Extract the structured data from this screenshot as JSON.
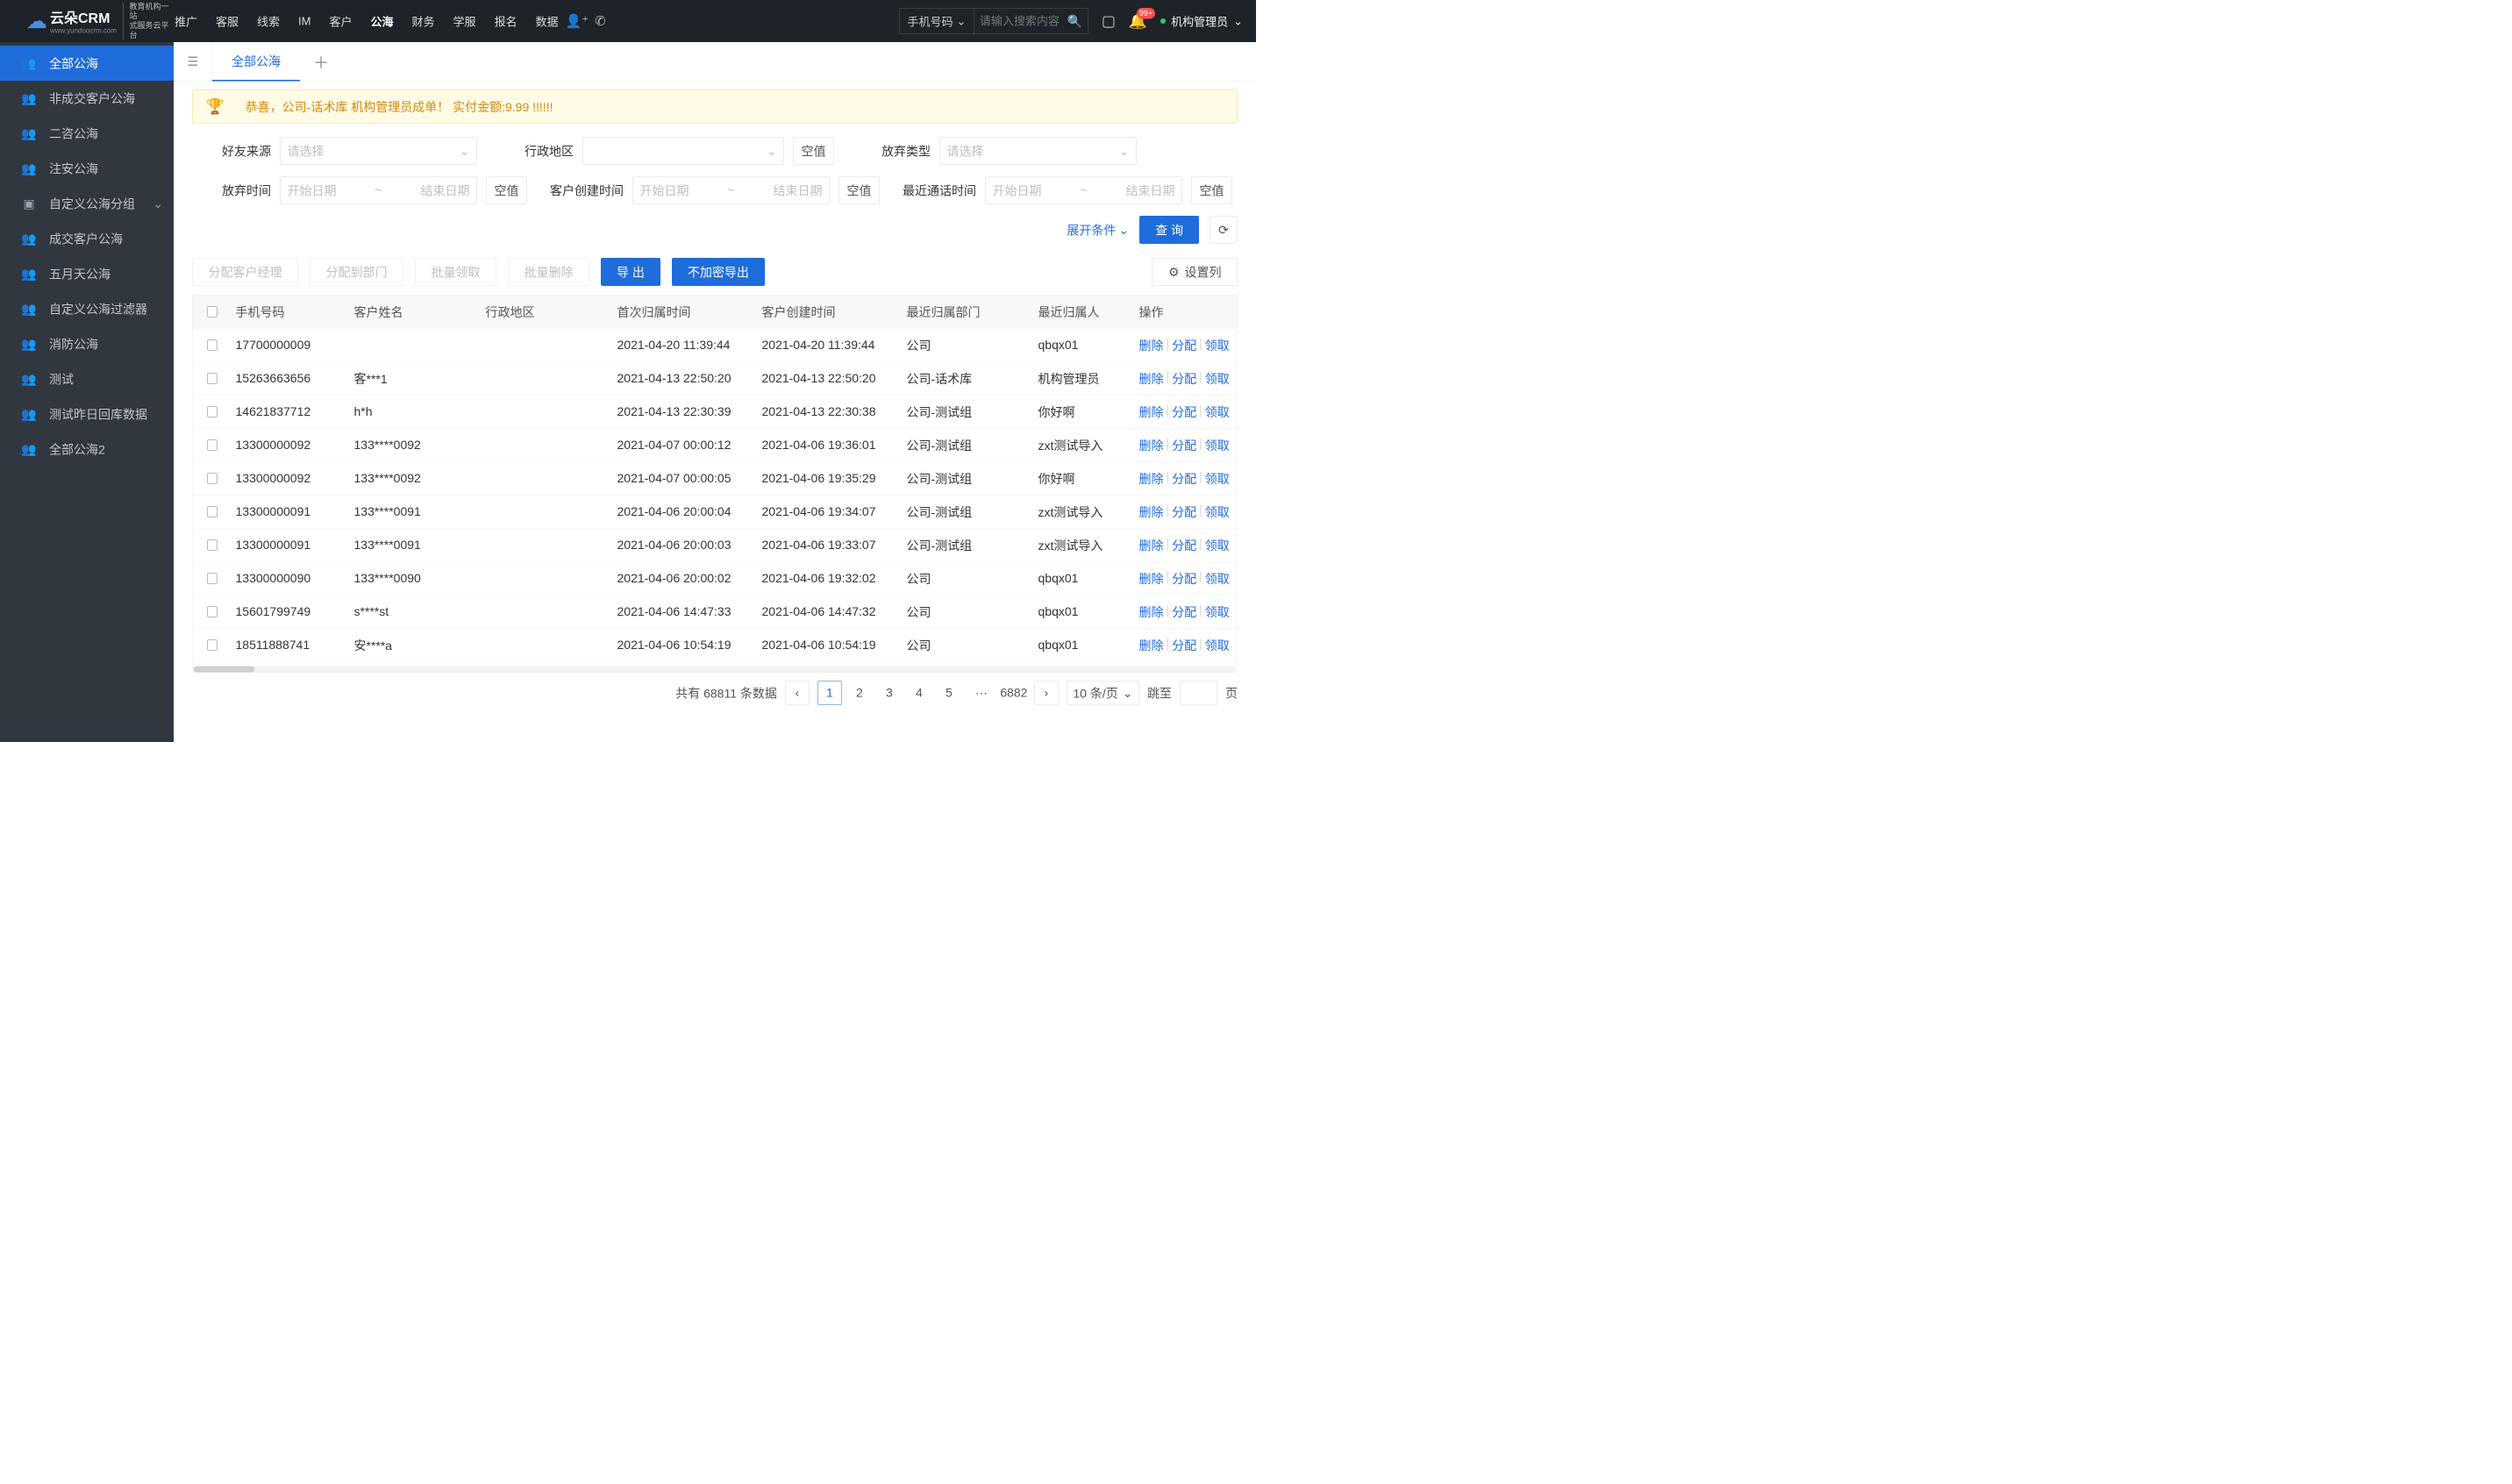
{
  "logo": {
    "main": "云朵CRM",
    "sub1": "教育机构一站",
    "sub2": "式服务云平台",
    "url": "www.yunduocrm.com"
  },
  "nav": {
    "items": [
      "推广",
      "客服",
      "线索",
      "IM",
      "客户",
      "公海",
      "财务",
      "学服",
      "报名",
      "数据"
    ],
    "activeIndex": 5
  },
  "search": {
    "type": "手机号码",
    "placeholder": "请输入搜索内容"
  },
  "headerIcons": {
    "badge": "99+"
  },
  "user": {
    "name": "机构管理员"
  },
  "sidebar": {
    "items": [
      {
        "label": "全部公海",
        "icon": "people",
        "active": true
      },
      {
        "label": "非成交客户公海",
        "icon": "people"
      },
      {
        "label": "二咨公海",
        "icon": "people"
      },
      {
        "label": "注安公海",
        "icon": "people"
      },
      {
        "label": "自定义公海分组",
        "icon": "box",
        "chevron": true
      },
      {
        "label": "成交客户公海",
        "icon": "people"
      },
      {
        "label": "五月天公海",
        "icon": "people"
      },
      {
        "label": "自定义公海过滤器",
        "icon": "people"
      },
      {
        "label": "消防公海",
        "icon": "people"
      },
      {
        "label": "测试",
        "icon": "people"
      },
      {
        "label": "测试昨日回库数据",
        "icon": "people"
      },
      {
        "label": "全部公海2",
        "icon": "people"
      }
    ]
  },
  "tabs": {
    "active": "全部公海"
  },
  "banner": {
    "text": "恭喜，公司-话术库  机构管理员成单！  实付金额:9.99 !!!!!!"
  },
  "filters": {
    "friendSourceLabel": "好友来源",
    "friendSourcePh": "请选择",
    "regionLabel": "行政地区",
    "emptyBtn": "空值",
    "abandonTypeLabel": "放弃类型",
    "abandonTypePh": "请选择",
    "abandonTimeLabel": "放弃时间",
    "startPh": "开始日期",
    "endPh": "结束日期",
    "createTimeLabel": "客户创建时间",
    "lastCallLabel": "最近通话时间",
    "expand": "展开条件",
    "query": "查 询"
  },
  "toolbar": {
    "assignManager": "分配客户经理",
    "assignDept": "分配到部门",
    "batchClaim": "批量领取",
    "batchDelete": "批量删除",
    "export": "导 出",
    "exportPlain": "不加密导出",
    "setCols": "设置列"
  },
  "table": {
    "headers": [
      "手机号码",
      "客户姓名",
      "行政地区",
      "首次归属时间",
      "客户创建时间",
      "最近归属部门",
      "最近归属人",
      "操作"
    ],
    "ops": {
      "delete": "删除",
      "assign": "分配",
      "claim": "领取"
    },
    "rows": [
      {
        "phone": "17700000009",
        "name": "",
        "region": "",
        "first": "2021-04-20 11:39:44",
        "created": "2021-04-20 11:39:44",
        "dept": "公司",
        "owner": "qbqx01"
      },
      {
        "phone": "15263663656",
        "name": "客***1",
        "region": "",
        "first": "2021-04-13 22:50:20",
        "created": "2021-04-13 22:50:20",
        "dept": "公司-话术库",
        "owner": "机构管理员"
      },
      {
        "phone": "14621837712",
        "name": "h*h",
        "region": "",
        "first": "2021-04-13 22:30:39",
        "created": "2021-04-13 22:30:38",
        "dept": "公司-测试组",
        "owner": "你好啊"
      },
      {
        "phone": "13300000092",
        "name": "133****0092",
        "region": "",
        "first": "2021-04-07 00:00:12",
        "created": "2021-04-06 19:36:01",
        "dept": "公司-测试组",
        "owner": "zxt测试导入"
      },
      {
        "phone": "13300000092",
        "name": "133****0092",
        "region": "",
        "first": "2021-04-07 00:00:05",
        "created": "2021-04-06 19:35:29",
        "dept": "公司-测试组",
        "owner": "你好啊"
      },
      {
        "phone": "13300000091",
        "name": "133****0091",
        "region": "",
        "first": "2021-04-06 20:00:04",
        "created": "2021-04-06 19:34:07",
        "dept": "公司-测试组",
        "owner": "zxt测试导入"
      },
      {
        "phone": "13300000091",
        "name": "133****0091",
        "region": "",
        "first": "2021-04-06 20:00:03",
        "created": "2021-04-06 19:33:07",
        "dept": "公司-测试组",
        "owner": "zxt测试导入"
      },
      {
        "phone": "13300000090",
        "name": "133****0090",
        "region": "",
        "first": "2021-04-06 20:00:02",
        "created": "2021-04-06 19:32:02",
        "dept": "公司",
        "owner": "qbqx01"
      },
      {
        "phone": "15601799749",
        "name": "s****st",
        "region": "",
        "first": "2021-04-06 14:47:33",
        "created": "2021-04-06 14:47:32",
        "dept": "公司",
        "owner": "qbqx01"
      },
      {
        "phone": "18511888741",
        "name": "安****a",
        "region": "",
        "first": "2021-04-06 10:54:19",
        "created": "2021-04-06 10:54:19",
        "dept": "公司",
        "owner": "qbqx01"
      }
    ]
  },
  "pager": {
    "totalPrefix": "共有",
    "total": "68811",
    "totalSuffix": "条数据",
    "pages": [
      "1",
      "2",
      "3",
      "4",
      "5"
    ],
    "ellipsis": "···",
    "last": "6882",
    "perPage": "10 条/页",
    "jumpTo": "跳至",
    "pageSuffix": "页"
  }
}
